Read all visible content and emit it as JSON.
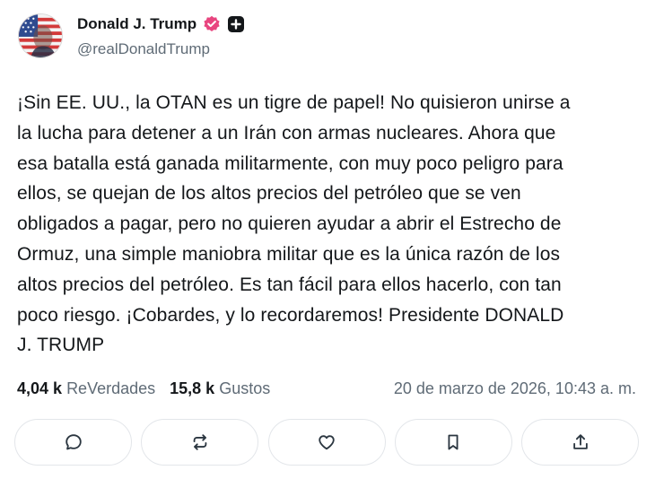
{
  "author": {
    "display_name": "Donald J. Trump",
    "handle": "@realDonaldTrump",
    "avatar_icon": "flag-portrait-avatar",
    "badges": [
      "verified-badge-icon",
      "plus-badge-icon"
    ],
    "verified_color": "#e8457f"
  },
  "post": {
    "lines": [
      "¡Sin EE. UU., la OTAN es un tigre de papel! No quisieron unirse a",
      "la lucha para detener a un Irán con armas nucleares. Ahora que",
      "esa batalla está ganada militarmente, con muy poco peligro para",
      "ellos, se quejan de los altos precios del petróleo que se ven",
      "obligados a pagar, pero no quieren ayudar a abrir el Estrecho de",
      "Ormuz, una simple maniobra militar que es la única razón de los",
      "altos precios del petróleo. Es tan fácil para ellos hacerlo, con tan",
      "poco riesgo. ¡Cobardes, y lo recordaremos! Presidente DONALD",
      "J. TRUMP"
    ]
  },
  "stats": {
    "reposts_count": "4,04 k",
    "reposts_label": "ReVerdades",
    "likes_count": "15,8 k",
    "likes_label": "Gustos",
    "timestamp": "20 de marzo de 2026, 10:43 a. m."
  },
  "actions": {
    "icons": [
      "reply-icon",
      "repost-icon",
      "like-icon",
      "bookmark-icon",
      "share-icon"
    ]
  }
}
